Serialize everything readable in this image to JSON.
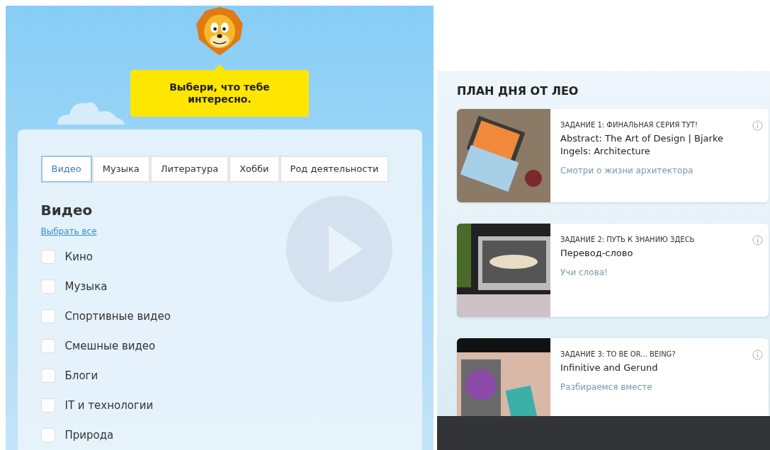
{
  "mascot": {
    "speech": "Выбери, что тебе интересно."
  },
  "interests": {
    "tabs": [
      {
        "label": "Видео",
        "selected": true
      },
      {
        "label": "Музыка",
        "selected": false
      },
      {
        "label": "Литература",
        "selected": false
      },
      {
        "label": "Хобби",
        "selected": false
      },
      {
        "label": "Род деятельности",
        "selected": false
      }
    ],
    "heading": "Видео",
    "select_all": "Выбрать все",
    "options": [
      {
        "label": "Кино",
        "checked": false
      },
      {
        "label": "Музыка",
        "checked": false
      },
      {
        "label": "Спортивные видео",
        "checked": false
      },
      {
        "label": "Смешные видео",
        "checked": false
      },
      {
        "label": "Блоги",
        "checked": false
      },
      {
        "label": "IT и технологии",
        "checked": false
      },
      {
        "label": "Природа",
        "checked": false
      }
    ]
  },
  "day_plan": {
    "title": "ПЛАН ДНЯ ОТ ЛЕО",
    "tasks": [
      {
        "label": "ЗАДАНИЕ 1: ФИНАЛЬНАЯ СЕРИЯ ТУТ!",
        "title": "Abstract: The Art of Design | Bjarke Ingels: Architecture",
        "subtitle": "Смотри о жизни архитектора",
        "kind": "laptop"
      },
      {
        "label": "ЗАДАНИЕ 2: ПУТЬ К ЗНАНИЮ ЗДЕСЬ",
        "title": "Перевод-слово",
        "subtitle": "Учи слова!",
        "kind": "car"
      },
      {
        "label": "ЗАДАНИЕ 3: TO BE OR... BEING?",
        "title": "Infinitive and Gerund",
        "subtitle": "Разбираемся вместе",
        "kind": "tunnel"
      }
    ]
  }
}
